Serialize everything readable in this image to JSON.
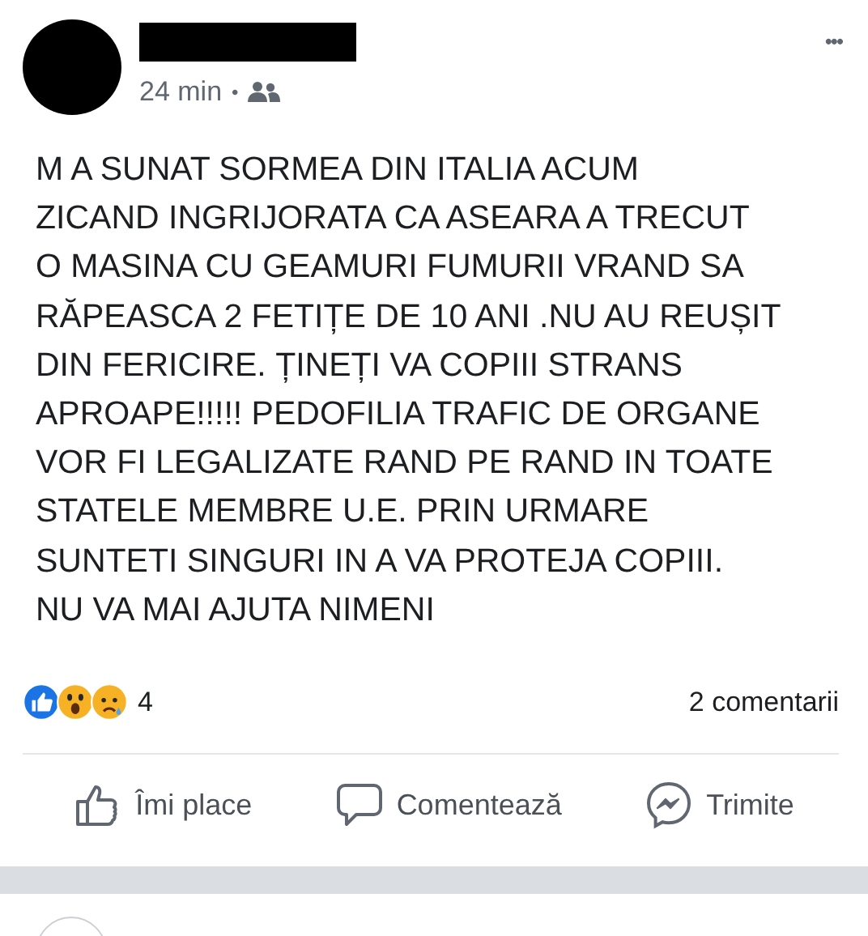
{
  "post": {
    "time": "24 min",
    "separator": "•",
    "more": "•••",
    "text": "M A SUNAT SORMEA DIN ITALIA ACUM\nZICAND INGRIJORATA CA ASEARA A TRECUT\nO MASINA CU GEAMURI FUMURII VRAND SA\nRĂPEASCA 2 FETIȚE DE 10 ANI .NU AU REUȘIT\nDIN FERICIRE. ȚINEȚI VA COPIII STRANS\nAPROAPE!!!!! PEDOFILIA TRAFIC DE ORGANE\nVOR FI LEGALIZATE RAND PE RAND IN TOATE\nSTATELE MEMBRE U.E. PRIN URMARE\nSUNTETI SINGURI IN A VA PROTEJA COPIII.\nNU VA MAI AJUTA NIMENI",
    "reactions": {
      "items": [
        {
          "kind": "like"
        },
        {
          "kind": "wow"
        },
        {
          "kind": "sad"
        }
      ],
      "count": "4"
    },
    "comments": "2 comentarii",
    "actions": [
      {
        "kind": "like",
        "label": "Îmi place"
      },
      {
        "kind": "comment",
        "label": "Comentează"
      },
      {
        "kind": "share",
        "label": "Trimite"
      }
    ]
  }
}
